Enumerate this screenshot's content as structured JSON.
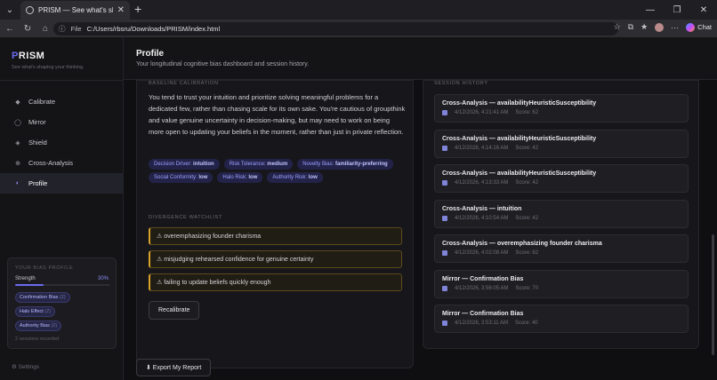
{
  "browser": {
    "tab_title": "PRISM — See what's shaping your",
    "url_prefix": "File",
    "url": "C:/Users/rbsru/Downloads/PRISM/index.html",
    "chat_label": "Chat"
  },
  "sidebar": {
    "brand": "PRISM",
    "brand_first": "P",
    "brand_rest": "RISM",
    "tagline": "See what's shaping your thinking.",
    "items": [
      {
        "label": "Calibrate",
        "icon": "diamond-icon"
      },
      {
        "label": "Mirror",
        "icon": "mirror-icon"
      },
      {
        "label": "Shield",
        "icon": "shield-icon"
      },
      {
        "label": "Cross-Analysis",
        "icon": "crosshair-icon"
      },
      {
        "label": "Profile",
        "icon": "profile-icon",
        "active": true
      }
    ],
    "bias_profile": {
      "heading": "YOUR BIAS PROFILE",
      "strength_label": "Strength",
      "strength_value": "30%",
      "strength_fraction": 0.3,
      "chips": [
        {
          "name": "Confirmation Bias",
          "count": "(2)"
        },
        {
          "name": "Halo Effect",
          "count": "(2)"
        },
        {
          "name": "Authority Bias",
          "count": "(2)"
        }
      ],
      "footer": "2 sessions recorded"
    },
    "settings_label": "⚙ Settings"
  },
  "header": {
    "title": "Profile",
    "subtitle": "Your longitudinal cognitive bias dashboard and session history."
  },
  "baseline": {
    "heading": "BASELINE CALIBRATION",
    "paragraph": "You tend to trust your intuition and prioritize solving meaningful problems for a dedicated few, rather than chasing scale for its own sake. You're cautious of groupthink and value genuine uncertainty in decision-making, but may need to work on being more open to updating your beliefs in the moment, rather than just in private reflection.",
    "tags": [
      {
        "key": "Decision Driver:",
        "value": "intuition"
      },
      {
        "key": "Risk Tolerance:",
        "value": "medium"
      },
      {
        "key": "Novelty Bias:",
        "value": "familiarity-preferring"
      },
      {
        "key": "Social Conformity:",
        "value": "low"
      },
      {
        "key": "Halo Risk:",
        "value": "low"
      },
      {
        "key": "Authority Risk:",
        "value": "low"
      }
    ],
    "watchlist_heading": "DIVERGENCE WATCHLIST",
    "watchlist": [
      "⚠ overemphasizing founder charisma",
      "⚠ misjudging rehearsed confidence for genuine certainty",
      "⚠ failing to update beliefs quickly enough"
    ],
    "recalibrate_label": "Recalibrate"
  },
  "history": {
    "heading": "SESSION HISTORY",
    "sessions": [
      {
        "title": "Cross-Analysis — availabilityHeuristicSusceptibility",
        "date": "4/12/2026, 4:21:41 AM",
        "score": "Score: 62"
      },
      {
        "title": "Cross-Analysis — availabilityHeuristicSusceptibility",
        "date": "4/12/2026, 4:14:16 AM",
        "score": "Score: 42"
      },
      {
        "title": "Cross-Analysis — availabilityHeuristicSusceptibility",
        "date": "4/12/2026, 4:13:33 AM",
        "score": "Score: 42"
      },
      {
        "title": "Cross-Analysis — intuition",
        "date": "4/12/2026, 4:10:54 AM",
        "score": "Score: 42"
      },
      {
        "title": "Cross-Analysis — overemphasizing founder charisma",
        "date": "4/12/2026, 4:02:08 AM",
        "score": "Score: 62"
      },
      {
        "title": "Mirror — Confirmation Bias",
        "date": "4/12/2026, 3:56:05 AM",
        "score": "Score: 70"
      },
      {
        "title": "Mirror — Confirmation Bias",
        "date": "4/12/2026, 3:53:11 AM",
        "score": "Score: 40"
      }
    ]
  },
  "export_label": "⬇ Export My Report"
}
